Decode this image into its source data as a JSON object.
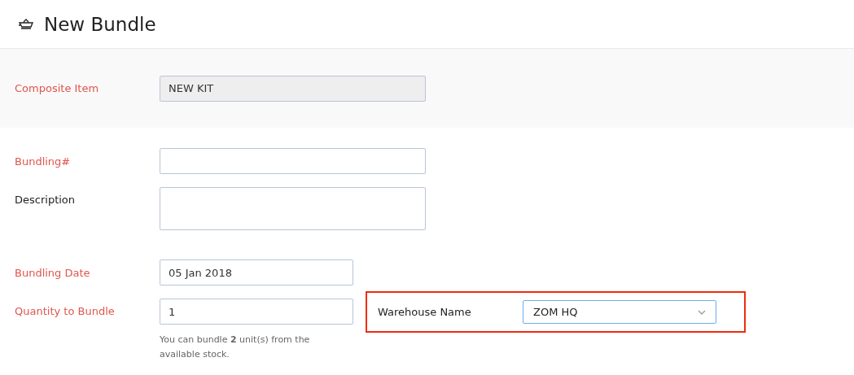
{
  "header": {
    "title": "New Bundle"
  },
  "composite": {
    "label": "Composite Item",
    "required": true,
    "value": "NEW KIT",
    "disabled": true
  },
  "fields": [
    {
      "label": "Bundling#",
      "required": true,
      "kind": "text"
    },
    {
      "label": "Description",
      "required": false,
      "kind": "textarea"
    }
  ],
  "date": {
    "label": "Bundling Date",
    "required": true,
    "value": "05 Jan 2018"
  },
  "quantity": {
    "label": "Quantity to Bundle",
    "required": true,
    "value": "1",
    "help": "You can bundle **2** unit(s) from the available stock."
  },
  "warehouse": {
    "label": "Warehouse Name",
    "value": "ZOM HQ",
    "highlighted": true,
    "focused": true
  }
}
